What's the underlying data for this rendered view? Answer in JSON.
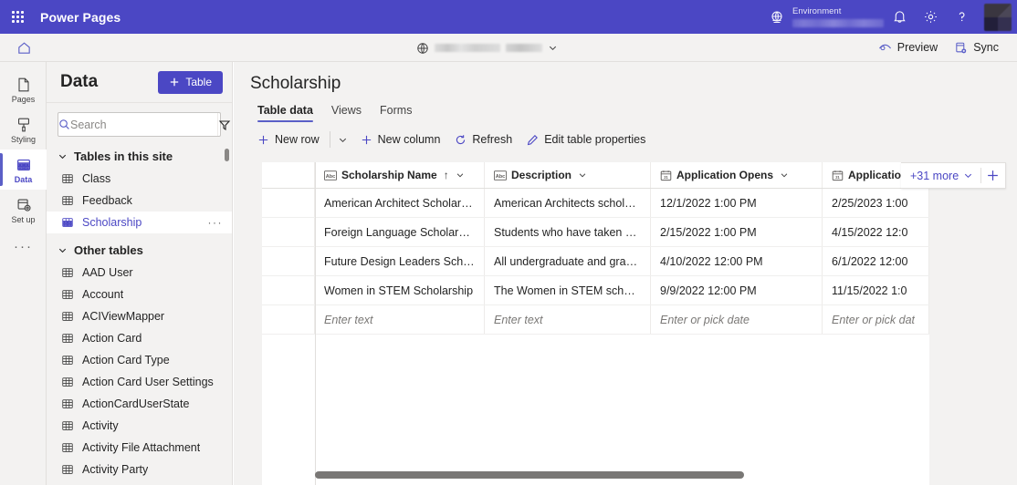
{
  "topbar": {
    "waffle_name": "app-launcher",
    "brand": "Power Pages",
    "environment_label": "Environment",
    "environment_value": "",
    "icons": {
      "globe": "globe-icon",
      "notifications": "bell-icon",
      "settings": "gear-icon",
      "help": "question-mark-icon",
      "avatar": "user-avatar"
    },
    "brand_color": "#4b47c4"
  },
  "subbar": {
    "home_label": "Home",
    "site_name": "",
    "preview_label": "Preview",
    "sync_label": "Sync"
  },
  "rail": {
    "items": [
      {
        "label": "Pages",
        "icon": "page-icon",
        "active": false
      },
      {
        "label": "Styling",
        "icon": "paint-brush-icon",
        "active": false
      },
      {
        "label": "Data",
        "icon": "table-grid-icon",
        "active": true
      },
      {
        "label": "Set up",
        "icon": "setup-gear-icon",
        "active": false
      }
    ],
    "more_label": "···"
  },
  "sidebar": {
    "title": "Data",
    "new_table_button": "Table",
    "search_placeholder": "Search",
    "search_value": "",
    "filter_label": "Filter",
    "groups": [
      {
        "label": "Tables in this site",
        "items": [
          {
            "label": "Class",
            "selected": false
          },
          {
            "label": "Feedback",
            "selected": false
          },
          {
            "label": "Scholarship",
            "selected": true
          }
        ]
      },
      {
        "label": "Other tables",
        "items": [
          {
            "label": "AAD User",
            "selected": false
          },
          {
            "label": "Account",
            "selected": false
          },
          {
            "label": "ACIViewMapper",
            "selected": false
          },
          {
            "label": "Action Card",
            "selected": false
          },
          {
            "label": "Action Card Type",
            "selected": false
          },
          {
            "label": "Action Card User Settings",
            "selected": false
          },
          {
            "label": "ActionCardUserState",
            "selected": false
          },
          {
            "label": "Activity",
            "selected": false
          },
          {
            "label": "Activity File Attachment",
            "selected": false
          },
          {
            "label": "Activity Party",
            "selected": false
          }
        ]
      }
    ]
  },
  "main": {
    "page_title": "Scholarship",
    "tabs": [
      {
        "label": "Table data",
        "active": true
      },
      {
        "label": "Views",
        "active": false
      },
      {
        "label": "Forms",
        "active": false
      }
    ],
    "commands": [
      {
        "label": "New row",
        "icon": "plus-icon"
      },
      {
        "label": "New column",
        "icon": "plus-icon"
      },
      {
        "label": "Refresh",
        "icon": "refresh-icon"
      },
      {
        "label": "Edit table properties",
        "icon": "pencil-icon"
      }
    ],
    "new_row_caret": "chevron-down-icon"
  },
  "grid": {
    "columns": [
      {
        "label": "Scholarship Name",
        "type_icon": "abc-text-icon",
        "sorted": "asc",
        "sort_glyph": "↑"
      },
      {
        "label": "Description",
        "type_icon": "abc-text-icon",
        "sorted": ""
      },
      {
        "label": "Application Opens",
        "type_icon": "calendar-icon",
        "sorted": ""
      },
      {
        "label": "Application D",
        "type_icon": "calendar-icon",
        "sorted": ""
      }
    ],
    "rows": [
      {
        "name": "American Architect Scholarship",
        "description": "American Architects scholarship is...",
        "opens": "12/1/2022 1:00 PM",
        "due": "2/25/2023 1:00"
      },
      {
        "name": "Foreign Language Scholarship",
        "description": "Students who have taken at least ...",
        "opens": "2/15/2022 1:00 PM",
        "due": "4/15/2022 12:0"
      },
      {
        "name": "Future Design Leaders Scholarship",
        "description": "All undergraduate and graduate s...",
        "opens": "4/10/2022 12:00 PM",
        "due": "6/1/2022 12:00"
      },
      {
        "name": "Women in STEM Scholarship",
        "description": "The Women in STEM scholarship i...",
        "opens": "9/9/2022 12:00 PM",
        "due": "11/15/2022 1:0"
      }
    ],
    "new_row_placeholders": {
      "text": "Enter text",
      "date": "Enter or pick date",
      "date_truncated": "Enter or pick dat"
    },
    "more_columns_label": "+31 more",
    "add_column_label": "Add column"
  }
}
